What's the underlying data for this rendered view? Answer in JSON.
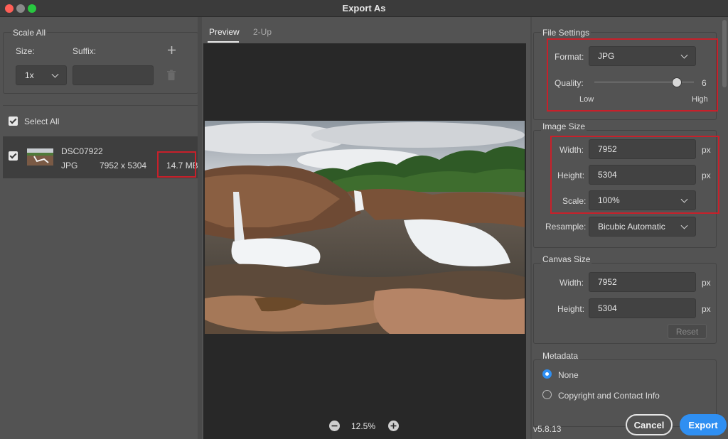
{
  "window": {
    "title": "Export As"
  },
  "left": {
    "scale_all_label": "Scale All",
    "size_label": "Size:",
    "suffix_label": "Suffix:",
    "size_value": "1x",
    "suffix_value": "",
    "select_all_label": "Select All",
    "asset": {
      "name": "DSC07922",
      "format": "JPG",
      "dimensions": "7952 x 5304",
      "file_size": "14.7 MB"
    }
  },
  "center": {
    "tabs": [
      {
        "label": "Preview"
      },
      {
        "label": "2-Up"
      }
    ],
    "zoom": "12.5%"
  },
  "file_settings": {
    "title": "File Settings",
    "format_label": "Format:",
    "format_value": "JPG",
    "quality_label": "Quality:",
    "quality_value": "6",
    "quality_fraction": 0.83,
    "low_label": "Low",
    "high_label": "High"
  },
  "image_size": {
    "title": "Image Size",
    "width_label": "Width:",
    "width_value": "7952",
    "height_label": "Height:",
    "height_value": "5304",
    "scale_label": "Scale:",
    "scale_value": "100%",
    "resample_label": "Resample:",
    "resample_value": "Bicubic Automatic",
    "unit": "px"
  },
  "canvas_size": {
    "title": "Canvas Size",
    "width_label": "Width:",
    "width_value": "7952",
    "height_label": "Height:",
    "height_value": "5304",
    "unit": "px",
    "reset_label": "Reset"
  },
  "metadata": {
    "title": "Metadata",
    "options": [
      {
        "label": "None"
      },
      {
        "label": "Copyright and Contact Info"
      }
    ]
  },
  "footer": {
    "version": "v5.8.13",
    "cancel_label": "Cancel",
    "export_label": "Export"
  },
  "colors": {
    "accent": "#2f8ff2",
    "highlight": "#c8202a",
    "panel": "#535353",
    "preview_bg": "#282828"
  },
  "icons": [
    "add-icon",
    "trash-icon",
    "chevron-down-icon",
    "zoom-out-icon",
    "zoom-in-icon",
    "checkbox-checked-icon"
  ]
}
